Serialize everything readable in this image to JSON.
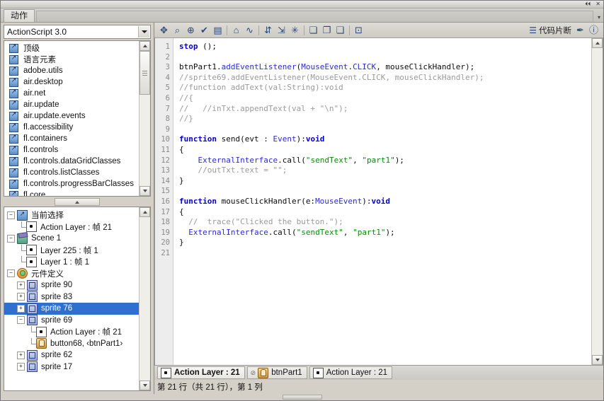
{
  "window": {
    "panel_tab": "动作",
    "minimize_label": "⏴⏴",
    "close_label": "✕",
    "menu_arrow": "▾"
  },
  "sidebar": {
    "language_select": {
      "value": "ActionScript 3.0",
      "caret_icon": "chevron-down-icon"
    },
    "class_list": [
      {
        "icon": "actionscript-package-icon",
        "label": "顶级"
      },
      {
        "icon": "actionscript-package-icon",
        "label": "语言元素"
      },
      {
        "icon": "actionscript-package-icon",
        "label": "adobe.utils"
      },
      {
        "icon": "actionscript-package-icon",
        "label": "air.desktop"
      },
      {
        "icon": "actionscript-package-icon",
        "label": "air.net"
      },
      {
        "icon": "actionscript-package-icon",
        "label": "air.update"
      },
      {
        "icon": "actionscript-package-icon",
        "label": "air.update.events"
      },
      {
        "icon": "actionscript-package-icon",
        "label": "fl.accessibility"
      },
      {
        "icon": "actionscript-package-icon",
        "label": "fl.containers"
      },
      {
        "icon": "actionscript-package-icon",
        "label": "fl.controls"
      },
      {
        "icon": "actionscript-package-icon",
        "label": "fl.controls.dataGridClasses"
      },
      {
        "icon": "actionscript-package-icon",
        "label": "fl.controls.listClasses"
      },
      {
        "icon": "actionscript-package-icon",
        "label": "fl.controls.progressBarClasses"
      },
      {
        "icon": "actionscript-package-icon",
        "label": "fl.core"
      }
    ],
    "tree": [
      {
        "label": "当前选择",
        "icon": "actionscript-package-icon",
        "depth": 0,
        "expander": "−",
        "selected": false
      },
      {
        "label": "Action Layer : 帧 21",
        "icon": "frame-icon",
        "depth": 1,
        "expander": "",
        "selected": false
      },
      {
        "label": "Scene 1",
        "icon": "scene-icon",
        "depth": 0,
        "expander": "−",
        "selected": false
      },
      {
        "label": "Layer 225 : 帧 1",
        "icon": "frame-icon",
        "depth": 1,
        "expander": "",
        "selected": false
      },
      {
        "label": "Layer 1 : 帧 1",
        "icon": "frame-icon",
        "depth": 1,
        "expander": "",
        "selected": false
      },
      {
        "label": "元件定义",
        "icon": "symbol-definition-icon",
        "depth": 0,
        "expander": "−",
        "selected": false
      },
      {
        "label": "sprite 90",
        "icon": "sprite-icon",
        "depth": 1,
        "expander": "+",
        "selected": false
      },
      {
        "label": "sprite 83",
        "icon": "sprite-icon",
        "depth": 1,
        "expander": "+",
        "selected": false
      },
      {
        "label": "sprite 76",
        "icon": "sprite-icon",
        "depth": 1,
        "expander": "+",
        "selected": true
      },
      {
        "label": "sprite 69",
        "icon": "sprite-icon",
        "depth": 1,
        "expander": "−",
        "selected": false
      },
      {
        "label": "Action Layer : 帧 21",
        "icon": "frame-icon",
        "depth": 2,
        "expander": "",
        "selected": false
      },
      {
        "label": "button68, ‹btnPart1›",
        "icon": "button-icon",
        "depth": 2,
        "expander": "",
        "selected": false
      },
      {
        "label": "sprite 62",
        "icon": "sprite-icon",
        "depth": 1,
        "expander": "+",
        "selected": false
      },
      {
        "label": "sprite 17",
        "icon": "sprite-icon",
        "depth": 1,
        "expander": "+",
        "selected": false
      }
    ]
  },
  "toolbar": {
    "left_tools": [
      {
        "name": "add-script-icon",
        "glyph": "✥"
      },
      {
        "name": "find-icon",
        "glyph": "⌕"
      },
      {
        "name": "find-replace-icon",
        "glyph": "⊕"
      },
      {
        "name": "check-syntax-icon",
        "glyph": "✔"
      },
      {
        "name": "auto-format-icon",
        "glyph": "▤"
      },
      {
        "name": "show-code-hint-icon",
        "glyph": "⌂"
      },
      {
        "name": "debug-options-icon",
        "glyph": "∿"
      },
      {
        "name": "collapse-between-braces-icon",
        "glyph": "⇵"
      },
      {
        "name": "collapse-selection-icon",
        "glyph": "⇲"
      },
      {
        "name": "expand-all-icon",
        "glyph": "✳"
      },
      {
        "name": "apply-block-comment-icon",
        "glyph": "❏"
      },
      {
        "name": "apply-line-comment-icon",
        "glyph": "❐"
      },
      {
        "name": "remove-comment-icon",
        "glyph": "❑"
      },
      {
        "name": "show-hide-toolbox-icon",
        "glyph": "⊡"
      }
    ],
    "snippets_label": "代码片断",
    "snippets_icon": "code-snippets-icon",
    "pin_icon": "pin-script-icon",
    "help_icon": "help-icon"
  },
  "editor": {
    "line_numbers": [
      "1",
      "2",
      "3",
      "4",
      "5",
      "6",
      "7",
      "8",
      "9",
      "10",
      "11",
      "12",
      "13",
      "14",
      "15",
      "16",
      "17",
      "18",
      "19",
      "20",
      "21"
    ],
    "lines": [
      [
        {
          "t": "stop",
          "c": "kw"
        },
        {
          "t": " ();",
          "c": "pln"
        }
      ],
      [
        {
          "t": "",
          "c": "pln"
        }
      ],
      [
        {
          "t": "btnPart1.",
          "c": "pln"
        },
        {
          "t": "addEventListener",
          "c": "cls"
        },
        {
          "t": "(",
          "c": "pln"
        },
        {
          "t": "MouseEvent",
          "c": "cls"
        },
        {
          "t": ".",
          "c": "pln"
        },
        {
          "t": "CLICK",
          "c": "cls"
        },
        {
          "t": ", mouseClickHandler);",
          "c": "pln"
        }
      ],
      [
        {
          "t": "//sprite69.addEventListener(MouseEvent.CLICK, mouseClickHandler);",
          "c": "cmt"
        }
      ],
      [
        {
          "t": "//function addText(val:String):void",
          "c": "cmt"
        }
      ],
      [
        {
          "t": "//{",
          "c": "cmt"
        }
      ],
      [
        {
          "t": "//   //inTxt.appendText(val + \"\\n\");",
          "c": "cmt"
        }
      ],
      [
        {
          "t": "//}",
          "c": "cmt"
        }
      ],
      [
        {
          "t": "",
          "c": "pln"
        }
      ],
      [
        {
          "t": "function",
          "c": "kw"
        },
        {
          "t": " send(evt : ",
          "c": "pln"
        },
        {
          "t": "Event",
          "c": "cls"
        },
        {
          "t": "):",
          "c": "pln"
        },
        {
          "t": "void",
          "c": "kw"
        }
      ],
      [
        {
          "t": "{",
          "c": "pln"
        }
      ],
      [
        {
          "t": "    ",
          "c": "pln"
        },
        {
          "t": "ExternalInterface",
          "c": "cls"
        },
        {
          "t": ".call(",
          "c": "pln"
        },
        {
          "t": "\"sendText\"",
          "c": "str"
        },
        {
          "t": ", ",
          "c": "pln"
        },
        {
          "t": "\"part1\"",
          "c": "str"
        },
        {
          "t": ");",
          "c": "pln"
        }
      ],
      [
        {
          "t": "    //outTxt.text = \"\";",
          "c": "cmt"
        }
      ],
      [
        {
          "t": "}",
          "c": "pln"
        }
      ],
      [
        {
          "t": "",
          "c": "pln"
        }
      ],
      [
        {
          "t": "function",
          "c": "kw"
        },
        {
          "t": " mouseClickHandler(e:",
          "c": "pln"
        },
        {
          "t": "MouseEvent",
          "c": "cls"
        },
        {
          "t": "):",
          "c": "pln"
        },
        {
          "t": "void",
          "c": "kw"
        }
      ],
      [
        {
          "t": "{",
          "c": "pln"
        }
      ],
      [
        {
          "t": "  //  trace(\"Clicked the button.\");",
          "c": "cmt"
        }
      ],
      [
        {
          "t": "  ",
          "c": "pln"
        },
        {
          "t": "ExternalInterface",
          "c": "cls"
        },
        {
          "t": ".call(",
          "c": "pln"
        },
        {
          "t": "\"sendText\"",
          "c": "str"
        },
        {
          "t": ", ",
          "c": "pln"
        },
        {
          "t": "\"part1\"",
          "c": "str"
        },
        {
          "t": ");",
          "c": "pln"
        }
      ],
      [
        {
          "t": "}",
          "c": "pln"
        }
      ],
      [
        {
          "t": "",
          "c": "pln"
        }
      ]
    ]
  },
  "bottom": {
    "tabs": [
      {
        "label": "Action Layer : 21",
        "icon": "frame-icon",
        "active": true,
        "pin": ""
      },
      {
        "label": "btnPart1",
        "icon": "button-icon",
        "active": false,
        "pin": "⊘"
      },
      {
        "label": "Action Layer : 21",
        "icon": "frame-icon",
        "active": false,
        "pin": ""
      }
    ],
    "status_text": "第 21 行（共 21 行），第 1 列"
  },
  "colors": {
    "selection": "#2f6fd0",
    "keyword": "#0000cc",
    "class": "#2b2bd6",
    "string": "#0a8a0a",
    "comment": "#9a9a9a",
    "chrome": "#d4d0c8"
  }
}
